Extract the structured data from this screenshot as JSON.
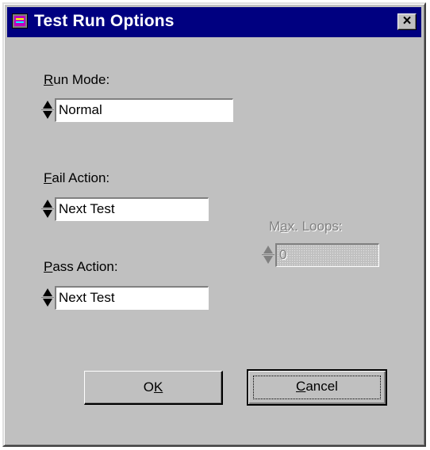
{
  "window": {
    "title": "Test Run Options",
    "close_symbol": "×",
    "app_icon": "test-run-app-icon"
  },
  "run_mode": {
    "label_accel": "R",
    "label_rest": "un Mode:",
    "value": "Normal"
  },
  "fail_action": {
    "label_accel": "F",
    "label_rest": "ail Action:",
    "value": "Next Test"
  },
  "pass_action": {
    "label_accel": "P",
    "label_rest": "ass Action:",
    "value": "Next Test"
  },
  "max_loops": {
    "label_pre": "M",
    "label_accel": "a",
    "label_rest": "x. Loops:",
    "value": "0",
    "enabled": false
  },
  "buttons": {
    "ok_pre": "O",
    "ok_accel": "K",
    "cancel_accel": "C",
    "cancel_rest": "ancel"
  },
  "colors": {
    "face": "#c0c0c0",
    "titlebar": "#000080",
    "title_text": "#ffffff",
    "disabled_text": "#808080"
  }
}
